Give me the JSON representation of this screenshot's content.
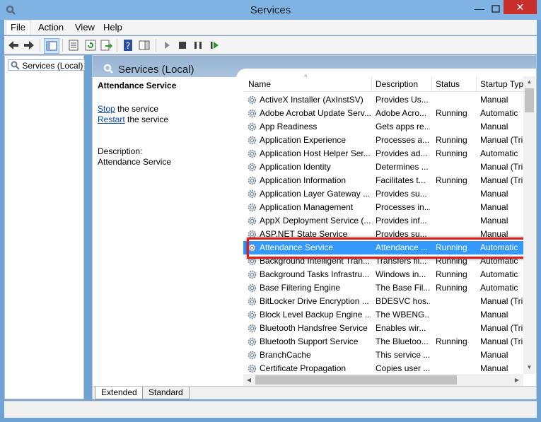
{
  "window": {
    "title": "Services",
    "min_glyph": "—",
    "close_glyph": "✕"
  },
  "menu": {
    "file": "File",
    "action": "Action",
    "view": "View",
    "help": "Help"
  },
  "tree": {
    "root": "Services (Local)"
  },
  "header": {
    "title": "Services (Local)"
  },
  "detail": {
    "service_name": "Attendance Service",
    "stop_link": "Stop",
    "stop_suffix": " the service",
    "restart_link": "Restart",
    "restart_suffix": " the service",
    "description_label": "Description:",
    "description_text": "Attendance Service"
  },
  "columns": {
    "name": "Name",
    "description": "Description",
    "status": "Status",
    "startup": "Startup Typ"
  },
  "rows": [
    {
      "name": "ActiveX Installer (AxInstSV)",
      "description": "Provides Us...",
      "status": "",
      "startup": "Manual"
    },
    {
      "name": "Adobe Acrobat Update Serv...",
      "description": "Adobe Acro...",
      "status": "Running",
      "startup": "Automatic"
    },
    {
      "name": "App Readiness",
      "description": "Gets apps re...",
      "status": "",
      "startup": "Manual"
    },
    {
      "name": "Application Experience",
      "description": "Processes a...",
      "status": "Running",
      "startup": "Manual (Tri"
    },
    {
      "name": "Application Host Helper Ser...",
      "description": "Provides ad...",
      "status": "Running",
      "startup": "Automatic"
    },
    {
      "name": "Application Identity",
      "description": "Determines ...",
      "status": "",
      "startup": "Manual (Tri"
    },
    {
      "name": "Application Information",
      "description": "Facilitates t...",
      "status": "Running",
      "startup": "Manual (Tri"
    },
    {
      "name": "Application Layer Gateway ...",
      "description": "Provides su...",
      "status": "",
      "startup": "Manual"
    },
    {
      "name": "Application Management",
      "description": "Processes in...",
      "status": "",
      "startup": "Manual"
    },
    {
      "name": "AppX Deployment Service (...",
      "description": "Provides inf...",
      "status": "",
      "startup": "Manual"
    },
    {
      "name": "ASP.NET State Service",
      "description": "Provides su...",
      "status": "",
      "startup": "Manual"
    },
    {
      "name": "Attendance Service",
      "description": "Attendance ...",
      "status": "Running",
      "startup": "Automatic",
      "selected": true
    },
    {
      "name": "Background Intelligent Tran...",
      "description": "Transfers fil...",
      "status": "Running",
      "startup": "Automatic"
    },
    {
      "name": "Background Tasks Infrastru...",
      "description": "Windows in...",
      "status": "Running",
      "startup": "Automatic"
    },
    {
      "name": "Base Filtering Engine",
      "description": "The Base Fil...",
      "status": "Running",
      "startup": "Automatic"
    },
    {
      "name": "BitLocker Drive Encryption ...",
      "description": "BDESVC hos...",
      "status": "",
      "startup": "Manual (Tri"
    },
    {
      "name": "Block Level Backup Engine ...",
      "description": "The WBENG...",
      "status": "",
      "startup": "Manual"
    },
    {
      "name": "Bluetooth Handsfree Service",
      "description": "Enables wir...",
      "status": "",
      "startup": "Manual (Tri"
    },
    {
      "name": "Bluetooth Support Service",
      "description": "The Bluetoo...",
      "status": "Running",
      "startup": "Manual (Tri"
    },
    {
      "name": "BranchCache",
      "description": "This service ...",
      "status": "",
      "startup": "Manual"
    },
    {
      "name": "Certificate Propagation",
      "description": "Copies user ...",
      "status": "",
      "startup": "Manual"
    }
  ],
  "tabs": {
    "extended": "Extended",
    "standard": "Standard"
  },
  "colors": {
    "selection": "#3399ff",
    "highlight": "#e41b1b",
    "close": "#c7302b"
  }
}
